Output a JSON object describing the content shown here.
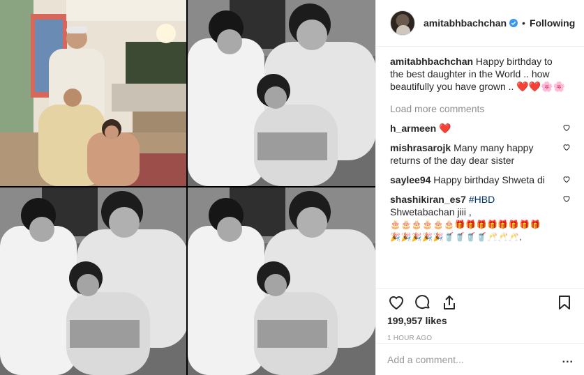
{
  "post": {
    "username": "amitabhbachchan",
    "follow_state": "Following",
    "separator": "•",
    "verified_icon": "verified-badge-icon"
  },
  "caption": {
    "username": "amitabhbachchan",
    "text": "Happy birthday to the best daughter in the World .. how beautifully you have grown ..",
    "emojis": "❤️❤️🌸🌸"
  },
  "load_more": "Load more comments",
  "comments": [
    {
      "username": "h_armeen",
      "text": "",
      "emoji": "❤️"
    },
    {
      "username": "mishrasarojk",
      "text": "Many many happy returns of the day dear sister"
    },
    {
      "username": "saylee94",
      "text": "Happy birthday Shweta di"
    },
    {
      "username": "shashikiran_es7",
      "hashtag": "#HBD",
      "text": "Shwetabachan jiii ,",
      "emoji_line_1": "🎂🎂🎂🎂🎂🎂🎁🎁🎁🎁🎁🎁🎁🎁",
      "emoji_line_2": "🎉🎉🎉🎉🎉🥤🥤🥤🥤🥂🥂🥂,"
    }
  ],
  "likes": "199,957 likes",
  "time_ago": "1 HOUR AGO",
  "add_comment_placeholder": "Add a comment...",
  "more_options": "...",
  "colors": {
    "heart": "#e0245e",
    "verified": "#3897f0",
    "muted": "#8e8e8e",
    "text": "#262626"
  }
}
